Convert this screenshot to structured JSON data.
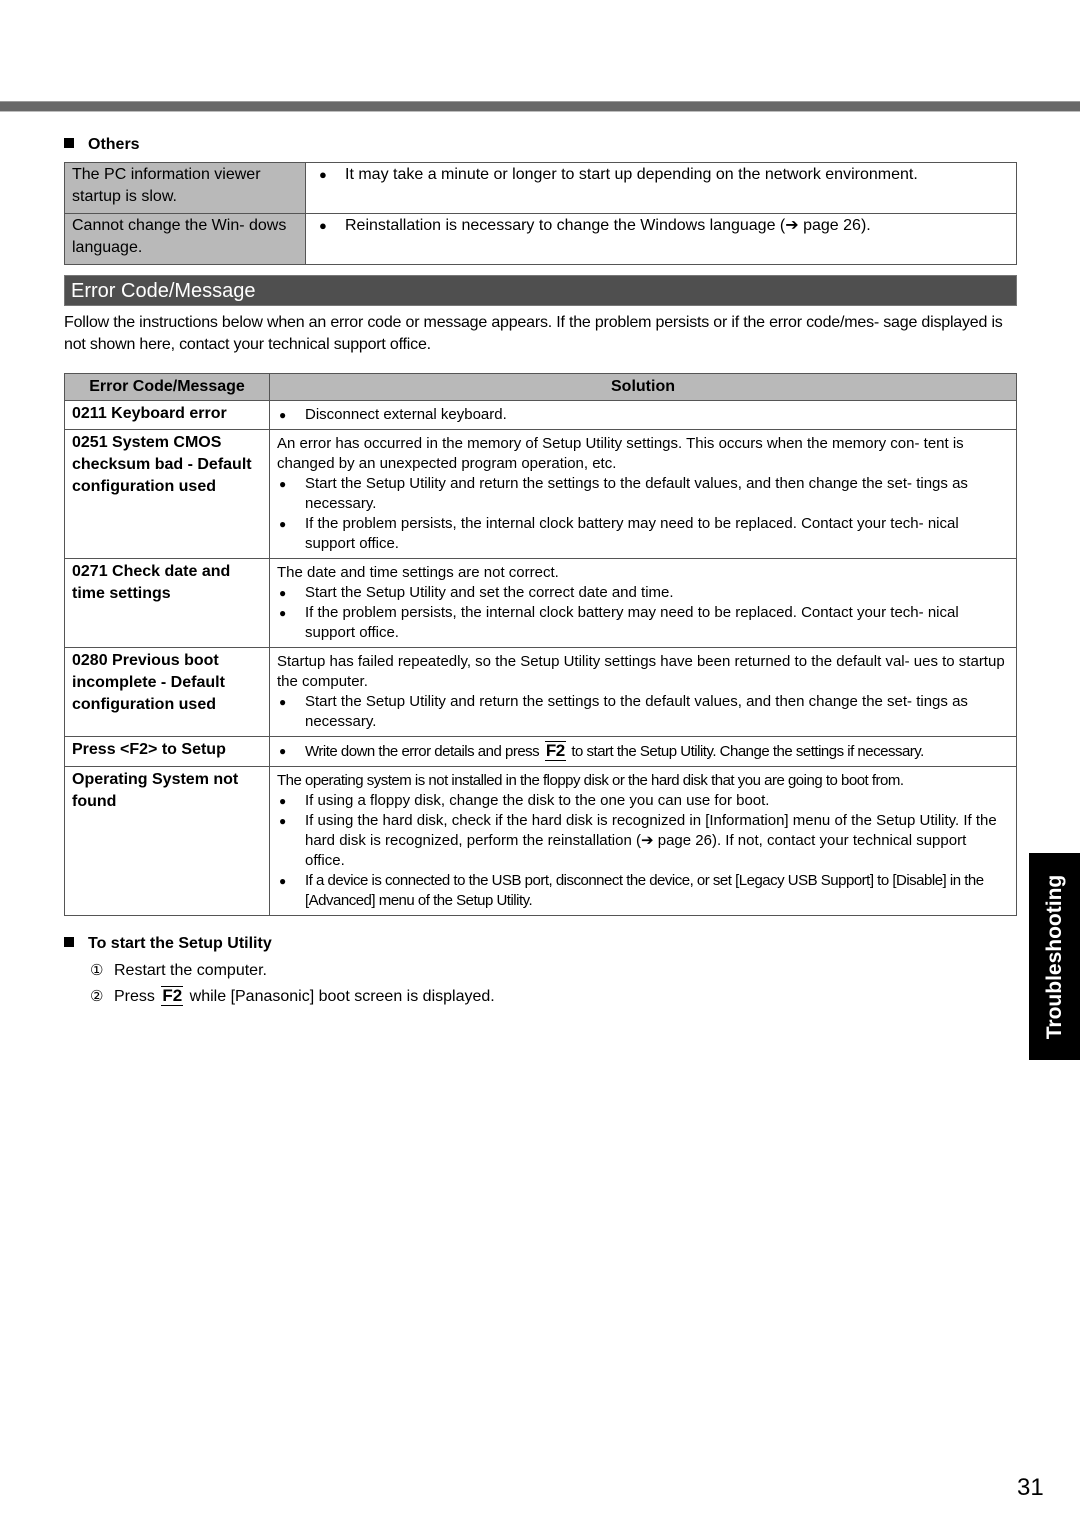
{
  "others": {
    "heading": "Others",
    "rows": [
      {
        "problem": "The PC information viewer startup is slow.",
        "solution": "It may take a minute or longer to start up depending on the network environment."
      },
      {
        "problem": "Cannot change the Win- dows language.",
        "solution": "Reinstallation is necessary to change the Windows language (➔ page 26)."
      }
    ]
  },
  "error_section": {
    "title": "Error Code/Message",
    "intro": "Follow the instructions below when an error code or message appears. If the problem persists or if the error code/mes- sage displayed is not shown here, contact your technical support office.",
    "table": {
      "headers": [
        "Error Code/Message",
        "Solution"
      ],
      "rows": [
        {
          "code": "0211 Keyboard error",
          "lead": "",
          "bullets": [
            "Disconnect external keyboard."
          ]
        },
        {
          "code": "0251 System CMOS checksum bad - Default configuration used",
          "lead": "An error has occurred in the memory of Setup Utility settings. This occurs when the memory con- tent is changed by an unexpected program operation, etc.",
          "bullets": [
            "Start the Setup Utility and return the settings to the default values, and then change the set- tings as necessary.",
            "If the problem persists, the internal clock battery may need to be replaced. Contact your tech- nical support office."
          ]
        },
        {
          "code": "0271 Check date and time settings",
          "lead": "The date and time settings are not correct.",
          "bullets": [
            "Start the Setup Utility and set the correct date and time.",
            "If the problem persists, the internal clock battery may need to be replaced. Contact your tech- nical support office."
          ]
        },
        {
          "code": "0280 Previous boot incomplete - Default configuration used",
          "lead": "Startup has failed repeatedly, so the Setup Utility settings have been returned to the default val- ues to startup the computer.",
          "bullets": [
            "Start the Setup Utility and return the settings to the default values, and then change the set- tings as necessary."
          ]
        },
        {
          "code": "Press <F2> to Setup",
          "lead": "",
          "bullets": [],
          "f2_bullet": {
            "before": "Write down the error details and press",
            "key": "F2",
            "after": "to start the Setup Utility. Change the settings if necessary."
          }
        },
        {
          "code": "Operating System not found",
          "lead": "The operating system is not installed in the floppy disk or the hard disk that you are going to boot from.",
          "bullets": [
            "If using a floppy disk, change the disk to the one you can use for boot.",
            "If using the hard disk, check if the hard disk is recognized in [Information] menu of the Setup Utility. If the hard disk is recognized, perform the reinstallation (➔ page 26). If not, contact your technical support office.",
            "If a device is connected to the USB port, disconnect the device, or set [Legacy USB Support] to [Disable] in the [Advanced] menu of the Setup Utility."
          ]
        }
      ]
    }
  },
  "setup": {
    "heading": "To start the Setup Utility",
    "steps": [
      {
        "num": "①",
        "before": "Restart the computer.",
        "key": "",
        "after": ""
      },
      {
        "num": "②",
        "before": "Press",
        "key": "F2",
        "after": "while [Panasonic] boot screen is displayed."
      }
    ]
  },
  "side_tab": "Troubleshooting",
  "page_number": "31",
  "icons": {
    "square_bullet": "black-square",
    "bullet": "●"
  }
}
